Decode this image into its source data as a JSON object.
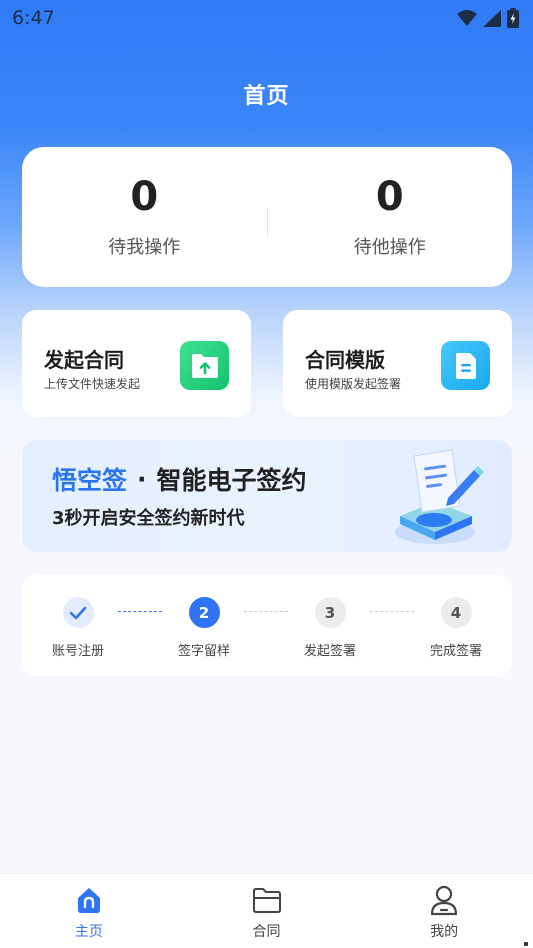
{
  "status_bar": {
    "time": "6:47"
  },
  "header": {
    "title": "首页"
  },
  "stats": [
    {
      "count": "0",
      "label": "待我操作"
    },
    {
      "count": "0",
      "label": "待他操作"
    }
  ],
  "actions": [
    {
      "title": "发起合同",
      "subtitle": "上传文件快速发起",
      "icon": "upload-folder-icon",
      "color": "#1ccd7b"
    },
    {
      "title": "合同模版",
      "subtitle": "使用模版发起签署",
      "icon": "document-icon",
      "color": "#27b2f3"
    }
  ],
  "banner": {
    "brand": "悟空签",
    "separator": "·",
    "slogan": "智能电子签约",
    "subtitle": "3秒开启安全签约新时代"
  },
  "steps": [
    {
      "number": "✓",
      "label": "账号注册",
      "state": "done"
    },
    {
      "number": "2",
      "label": "签字留样",
      "state": "active"
    },
    {
      "number": "3",
      "label": "发起签署",
      "state": "todo"
    },
    {
      "number": "4",
      "label": "完成签署",
      "state": "todo"
    }
  ],
  "tabbar": [
    {
      "label": "主页",
      "icon": "home-icon",
      "active": true
    },
    {
      "label": "合同",
      "icon": "folder-icon",
      "active": false
    },
    {
      "label": "我的",
      "icon": "user-icon",
      "active": false
    }
  ],
  "colors": {
    "primary": "#2f74f3",
    "green": "#1ccd7b",
    "cyan": "#27b2f3"
  }
}
